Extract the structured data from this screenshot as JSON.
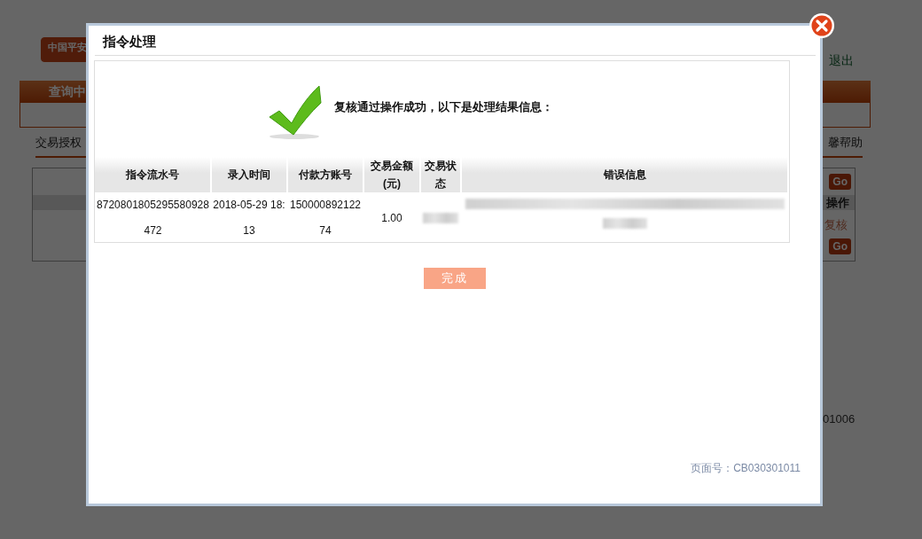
{
  "background_page": {
    "logo": {
      "text": "中国平安"
    },
    "logout_link": "退出",
    "nav_bar": {
      "title": "查询中"
    },
    "breadcrumb": "交易授权",
    "help_link": "馨帮助",
    "table": {
      "go_buttons": [
        "Go",
        "Go"
      ],
      "column_header": "操作",
      "action_link": "复核"
    },
    "footer_code": "01006"
  },
  "dialog": {
    "title": "指令处理",
    "message": "复核通过操作成功，以下是处理结果信息：",
    "table": {
      "columns": [
        "指令流水号",
        "录入时间",
        "付款方账号",
        "交易金额(元)",
        "交易状态",
        "错误信息"
      ],
      "rows": [
        {
          "cells": [
            {
              "kind": "text",
              "text": "8720801805295580928472"
            },
            {
              "kind": "text",
              "text": "2018-05-29 18:13"
            },
            {
              "kind": "text",
              "text": "15000089212274"
            },
            {
              "kind": "text",
              "text": "1.00"
            },
            {
              "kind": "blurred"
            },
            {
              "kind": "blurred"
            }
          ]
        }
      ]
    },
    "done_button": "完成",
    "page_number": "页面号：CB030301011"
  }
}
